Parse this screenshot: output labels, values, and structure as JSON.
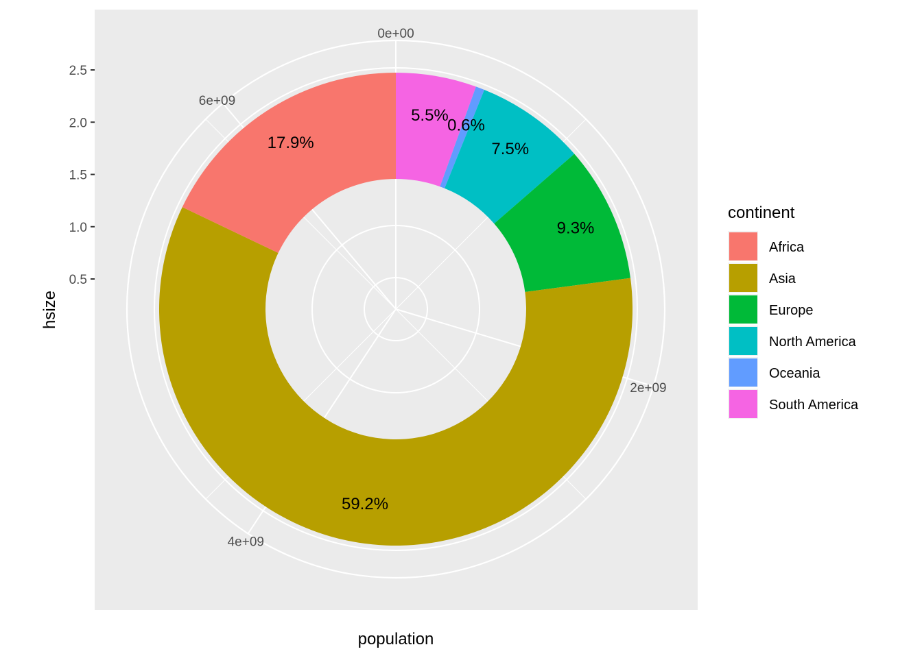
{
  "chart_data": {
    "type": "pie",
    "subtype": "donut (ggplot2 coord_polar)",
    "title": "",
    "xlabel": "population",
    "ylabel": "hsize",
    "y_ticks": [
      "0.5",
      "1.0",
      "1.5",
      "2.0",
      "2.5"
    ],
    "y_tick_values": [
      0.5,
      1.0,
      1.5,
      2.0,
      2.5
    ],
    "theta_ticks": [
      "0e+00",
      "2e+09",
      "4e+09",
      "6e+09"
    ],
    "theta_tick_values": [
      0,
      2000000000,
      4000000000,
      6000000000
    ],
    "theta_total": 6750000000,
    "legend": {
      "title": "continent",
      "placement": "right",
      "entries": [
        {
          "label": "Africa",
          "color": "#F8766D"
        },
        {
          "label": "Asia",
          "color": "#B79F00"
        },
        {
          "label": "Europe",
          "color": "#00BA38"
        },
        {
          "label": "North America",
          "color": "#00BFC4"
        },
        {
          "label": "Oceania",
          "color": "#619CFF"
        },
        {
          "label": "South America",
          "color": "#F564E3"
        }
      ]
    },
    "slices_clockwise_from_top": [
      {
        "label": "South America",
        "percent": 5.5,
        "text": "5.5%",
        "color": "#F564E3"
      },
      {
        "label": "Oceania",
        "percent": 0.6,
        "text": "0.6%",
        "color": "#619CFF"
      },
      {
        "label": "North America",
        "percent": 7.5,
        "text": "7.5%",
        "color": "#00BFC4"
      },
      {
        "label": "Europe",
        "percent": 9.3,
        "text": "9.3%",
        "color": "#00BA38"
      },
      {
        "label": "Asia",
        "percent": 59.2,
        "text": "59.2%",
        "color": "#B79F00"
      },
      {
        "label": "Africa",
        "percent": 17.9,
        "text": "17.9%",
        "color": "#F8766D"
      }
    ],
    "hsize_range": [
      0.5,
      2.5
    ],
    "grid": true,
    "panel_background": "#EBEBEB",
    "grid_color": "#FFFFFF"
  }
}
